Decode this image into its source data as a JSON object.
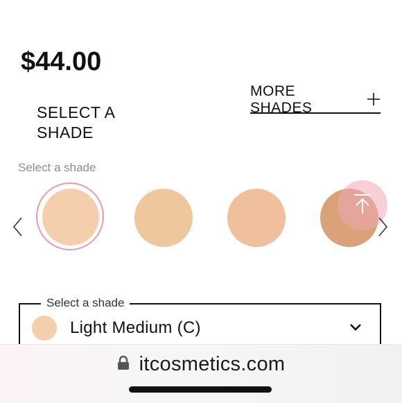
{
  "product": {
    "price": "$44.00"
  },
  "shade_section": {
    "heading": "SELECT A SHADE",
    "more_shades_label": "MORE SHADES",
    "hint": "Select a shade",
    "swatches": [
      {
        "name": "swatch-1",
        "color": "#f5cfad",
        "selected": true
      },
      {
        "name": "swatch-2",
        "color": "#efc79f"
      },
      {
        "name": "swatch-3",
        "color": "#f0c09c"
      },
      {
        "name": "swatch-4",
        "color": "#d9a278"
      }
    ],
    "selected_ring_color": "#e79aac"
  },
  "dropdown": {
    "legend": "Select a shade",
    "value": "Light Medium (C)",
    "swatch_color": "#f5cfad"
  },
  "browser": {
    "url": "itcosmetics.com"
  },
  "icons": {
    "prev": "chevron-left-icon",
    "next": "chevron-right-icon",
    "plus": "plus-icon",
    "scroll_top": "arrow-up-to-top-icon",
    "dropdown": "chevron-down-icon",
    "lock": "lock-icon"
  }
}
